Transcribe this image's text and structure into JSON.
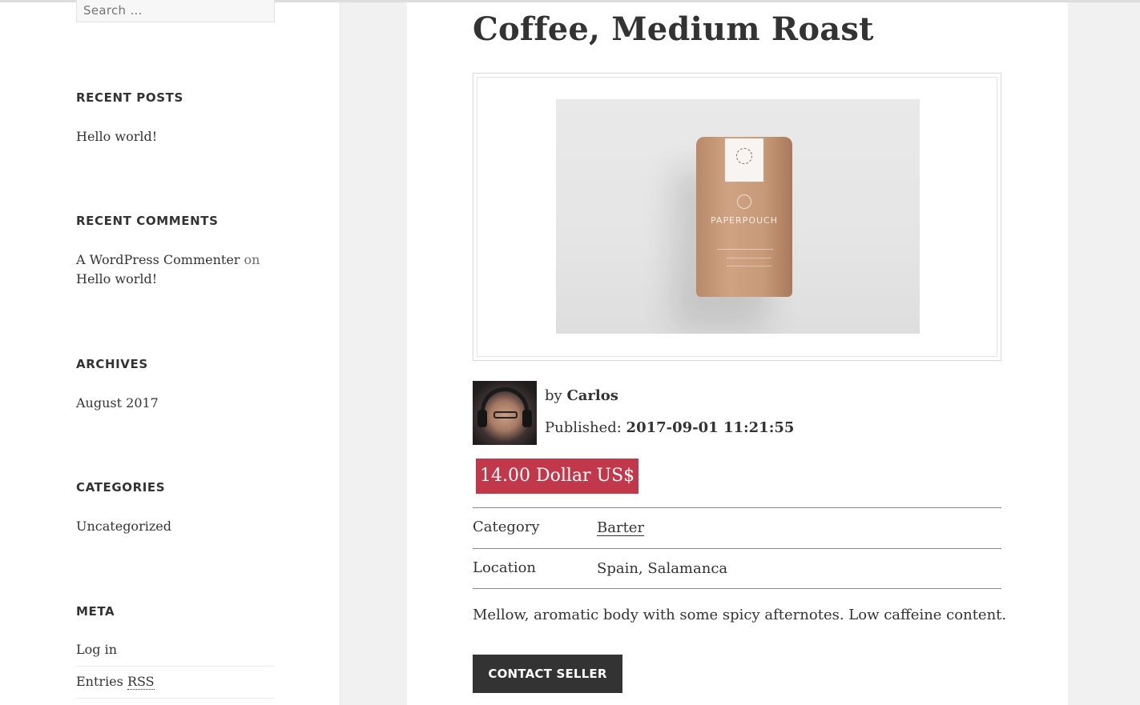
{
  "sidebar": {
    "search_placeholder": "Search …",
    "recent_posts": {
      "title": "RECENT POSTS",
      "items": [
        "Hello world!"
      ]
    },
    "recent_comments": {
      "title": "RECENT COMMENTS",
      "author": "A WordPress Commenter",
      "connector": "on",
      "post": "Hello world!"
    },
    "archives": {
      "title": "ARCHIVES",
      "items": [
        "August 2017"
      ]
    },
    "categories": {
      "title": "CATEGORIES",
      "items": [
        "Uncategorized"
      ]
    },
    "meta": {
      "title": "META",
      "log_in": "Log in",
      "entries": "Entries",
      "rss": "RSS"
    }
  },
  "post": {
    "title": "Coffee, Medium Roast",
    "by_label": "by",
    "author": "Carlos",
    "published_label": "Published:",
    "published_value": "2017-09-01 11:21:55",
    "price": "14.00 Dollar US$",
    "details": [
      {
        "key": "Category",
        "value": "Barter"
      },
      {
        "key": "Location",
        "value": "Spain, Salamanca"
      }
    ],
    "description": "Mellow, aromatic body with some spicy afternotes. Low caffeine content.",
    "contact_label": "CONTACT SELLER"
  },
  "colors": {
    "price_badge": "#c0384a",
    "button": "#333333"
  },
  "icons": {
    "product_image": "coffee-pouch-photo",
    "author_avatar": "author-photo"
  }
}
